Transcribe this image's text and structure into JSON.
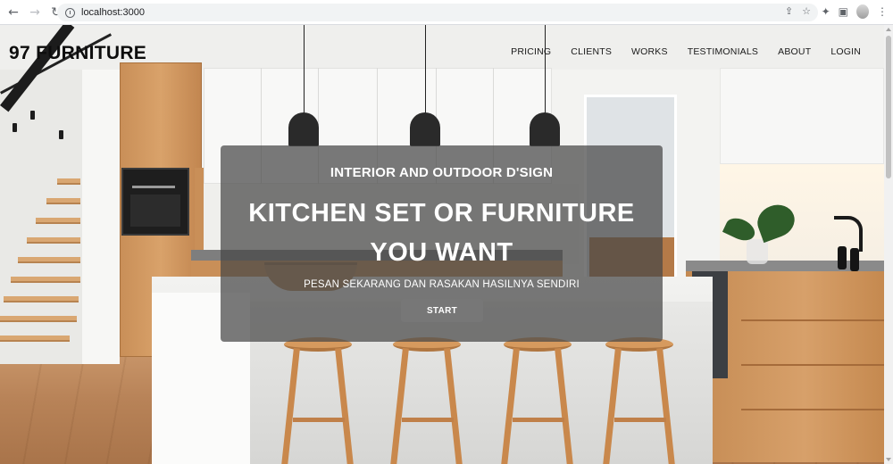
{
  "browser": {
    "back_icon": "arrow-left-icon",
    "forward_icon": "arrow-right-icon",
    "reload_icon": "reload-icon",
    "url": "localhost:3000",
    "toolbar_icons": [
      "share-icon",
      "star-icon",
      "extension-icon",
      "side-panel-icon",
      "profile-icon",
      "menu-icon"
    ]
  },
  "header": {
    "brand": "97 FURNITURE",
    "nav": [
      "PRICING",
      "CLIENTS",
      "WORKS",
      "TESTIMONIALS",
      "ABOUT",
      "LOGIN"
    ]
  },
  "hero": {
    "subtitle": "INTERIOR AND OUTDOOR D'SIGN",
    "title_line1": "KITCHEN SET OR FURNITURE",
    "title_line2": "YOU WANT",
    "description": "PESAN SEKARANG DAN RASAKAN HASILNYA SENDIRI",
    "button": "START"
  },
  "colors": {
    "overlay": "#464646",
    "brand_text": "#0d0d0d",
    "hero_text": "#ffffff"
  }
}
